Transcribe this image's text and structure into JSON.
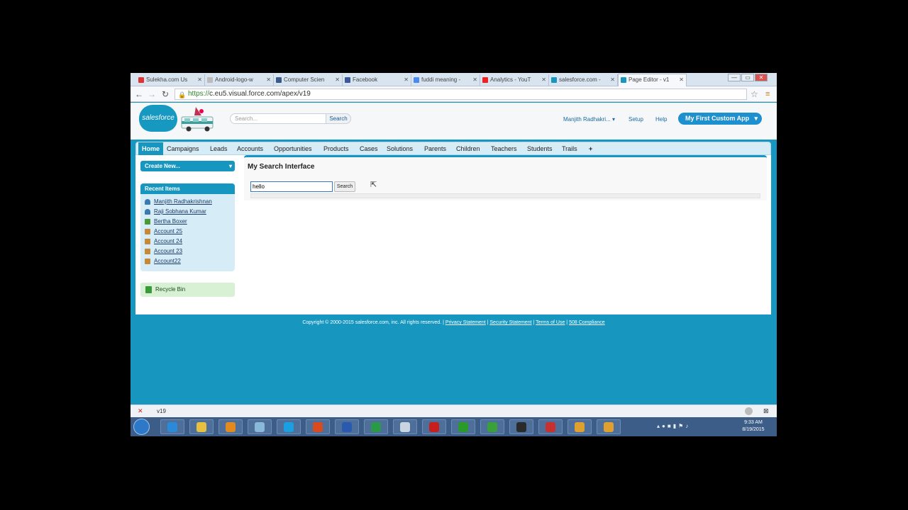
{
  "browser": {
    "tabs": [
      {
        "title": "Sulekha.com Us",
        "color": "#d33"
      },
      {
        "title": "Android-logo-w",
        "color": "#bbb"
      },
      {
        "title": "Computer Scien",
        "color": "#3a5a8a"
      },
      {
        "title": "Facebook",
        "color": "#3b5998"
      },
      {
        "title": "fuddi meaning -",
        "color": "#4a8af4"
      },
      {
        "title": "Analytics - YouT",
        "color": "#e22"
      },
      {
        "title": "salesforce.com -",
        "color": "#1797c0"
      },
      {
        "title": "Page Editor - v1",
        "color": "#1797c0",
        "active": true
      }
    ],
    "url_proto": "https://",
    "url_rest": "c.eu5.visual.force.com/apex/v19"
  },
  "sf": {
    "logo": "salesforce",
    "search_placeholder": "Search...",
    "search_button": "Search",
    "user_menu": "Manjith Radhakri...",
    "setup": "Setup",
    "help": "Help",
    "app_menu": "My First Custom App"
  },
  "nav": {
    "tabs": [
      "Home",
      "Campaigns",
      "Leads",
      "Accounts",
      "Opportunities",
      "Products",
      "Cases",
      "Solutions",
      "Parents",
      "Children",
      "Teachers",
      "Students",
      "Trails"
    ],
    "more": "+"
  },
  "sidebar": {
    "create_new": "Create New...",
    "recent_header": "Recent Items",
    "recent": [
      {
        "label": "Manjith Radhakrishnan",
        "icon": "person-icon",
        "color": "#3a7ab0"
      },
      {
        "label": "Raji Sobhana Kumar",
        "icon": "person-icon",
        "color": "#3a7ab0"
      },
      {
        "label": "Bertha Boxer",
        "icon": "lead-icon",
        "color": "#4a9a3a"
      },
      {
        "label": "Account 25",
        "icon": "account-icon",
        "color": "#c8883a"
      },
      {
        "label": "Account 24",
        "icon": "account-icon",
        "color": "#c8883a"
      },
      {
        "label": "Account 23",
        "icon": "account-icon",
        "color": "#c8883a"
      },
      {
        "label": "Account22",
        "icon": "account-icon",
        "color": "#c8883a"
      }
    ],
    "recycle_bin": "Recycle Bin"
  },
  "main": {
    "title": "My Search Interface",
    "query_value": "hello",
    "search_button": "Search"
  },
  "footer": {
    "copyright": "Copyright © 2000-2015 salesforce.com, inc. All rights reserved. |",
    "links": [
      "Privacy Statement",
      "Security Statement",
      "Terms of Use",
      "508 Compliance"
    ]
  },
  "downloads": {
    "item": "v19"
  },
  "taskbar": {
    "time": "9:33 AM",
    "date": "8/19/2015"
  }
}
